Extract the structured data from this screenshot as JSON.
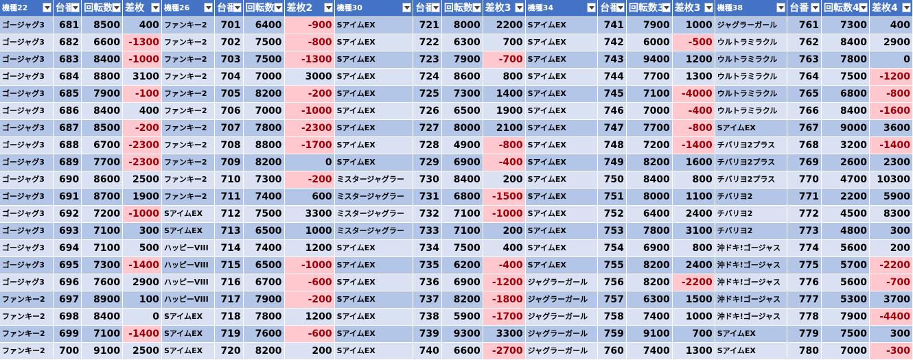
{
  "sheet": {
    "headers": [
      "機種22",
      "台番",
      "回転数",
      "差枚",
      "機種26",
      "台番",
      "回転数",
      "差枚2",
      "機種30",
      "台番",
      "回転数",
      "差枚3",
      "機種34",
      "台番",
      "回転数3",
      "差枚3",
      "機種38",
      "台番",
      "回転数4",
      "差枚4"
    ],
    "colors": {
      "header_bg": "#4472c4",
      "row_odd": "#b4c6e7",
      "row_even": "#d9e1f2",
      "negative_bg": "#ffc7ce",
      "negative_text": "#9c0006"
    },
    "icons": {
      "filter": "filter-dropdown-icon"
    },
    "rows": [
      [
        "ゴージャグ3",
        "681",
        "8500",
        "400",
        "ファンキー2",
        "701",
        "6400",
        "-900",
        "SアイムEX",
        "721",
        "8000",
        "2200",
        "SアイムEX",
        "741",
        "7900",
        "1000",
        "ジャグラーガール",
        "761",
        "7300",
        "400"
      ],
      [
        "ゴージャグ3",
        "682",
        "6600",
        "-1300",
        "ファンキー2",
        "702",
        "7500",
        "-800",
        "SアイムEX",
        "722",
        "6300",
        "700",
        "SアイムEX",
        "742",
        "6000",
        "-500",
        "ウルトラミラクル",
        "762",
        "8400",
        "2900"
      ],
      [
        "ゴージャグ3",
        "683",
        "8400",
        "-1000",
        "ファンキー2",
        "703",
        "7500",
        "-1300",
        "SアイムEX",
        "723",
        "7900",
        "-700",
        "SアイムEX",
        "743",
        "9400",
        "1200",
        "ウルトラミラクル",
        "763",
        "7800",
        "0"
      ],
      [
        "ゴージャグ3",
        "684",
        "8800",
        "3100",
        "ファンキー2",
        "704",
        "7000",
        "3000",
        "SアイムEX",
        "724",
        "8600",
        "800",
        "SアイムEX",
        "744",
        "7700",
        "1300",
        "ウルトラミラクル",
        "764",
        "7500",
        "-1200"
      ],
      [
        "ゴージャグ3",
        "685",
        "7900",
        "-100",
        "ファンキー2",
        "705",
        "8200",
        "-200",
        "SアイムEX",
        "725",
        "7300",
        "1400",
        "SアイムEX",
        "745",
        "7100",
        "-4000",
        "ウルトラミラクル",
        "765",
        "6800",
        "-800"
      ],
      [
        "ゴージャグ3",
        "686",
        "8400",
        "400",
        "ファンキー2",
        "706",
        "7000",
        "-1000",
        "SアイムEX",
        "726",
        "6500",
        "1900",
        "SアイムEX",
        "746",
        "7000",
        "-400",
        "ウルトラミラクル",
        "766",
        "8400",
        "-1600"
      ],
      [
        "ゴージャグ3",
        "687",
        "8500",
        "-200",
        "ファンキー2",
        "707",
        "7800",
        "-2300",
        "SアイムEX",
        "727",
        "8000",
        "2100",
        "SアイムEX",
        "747",
        "7700",
        "-800",
        "SアイムEX",
        "767",
        "9000",
        "3600"
      ],
      [
        "ゴージャグ3",
        "688",
        "6700",
        "-2300",
        "ファンキー2",
        "708",
        "8800",
        "-1700",
        "SアイムEX",
        "728",
        "4900",
        "-800",
        "SアイムEX",
        "748",
        "7200",
        "-1400",
        "チバリヨ2プラス",
        "768",
        "3200",
        "-1400"
      ],
      [
        "ゴージャグ3",
        "689",
        "7700",
        "-2300",
        "ファンキー2",
        "709",
        "8200",
        "0",
        "SアイムEX",
        "729",
        "6900",
        "-400",
        "SアイムEX",
        "749",
        "8200",
        "1600",
        "チバリヨ2プラス",
        "769",
        "2600",
        "2300"
      ],
      [
        "ゴージャグ3",
        "690",
        "8600",
        "2500",
        "ファンキー2",
        "710",
        "7300",
        "-200",
        "ミスタージャグラー",
        "730",
        "8400",
        "200",
        "SアイムEX",
        "750",
        "8400",
        "800",
        "チバリヨ2プラス",
        "770",
        "4700",
        "10300"
      ],
      [
        "ゴージャグ3",
        "691",
        "8700",
        "1900",
        "ファンキー2",
        "711",
        "7400",
        "600",
        "ミスタージャグラー",
        "731",
        "6800",
        "-1500",
        "SアイムEX",
        "751",
        "8000",
        "1100",
        "チバリヨ2",
        "771",
        "2200",
        "5900"
      ],
      [
        "ゴージャグ3",
        "692",
        "7200",
        "-1000",
        "SアイムEX",
        "712",
        "7500",
        "3300",
        "ミスタージャグラー",
        "732",
        "7100",
        "-1000",
        "SアイムEX",
        "752",
        "6400",
        "2400",
        "チバリヨ2",
        "772",
        "4500",
        "8300"
      ],
      [
        "ゴージャグ3",
        "693",
        "7100",
        "300",
        "SアイムEX",
        "713",
        "6500",
        "1000",
        "ミスタージャグラー",
        "733",
        "7100",
        "200",
        "SアイムEX",
        "753",
        "7800",
        "3100",
        "チバリヨ2",
        "773",
        "4800",
        "300"
      ],
      [
        "ゴージャグ3",
        "694",
        "7100",
        "500",
        "ハッピーVIII",
        "714",
        "7400",
        "1200",
        "SアイムEX",
        "734",
        "7500",
        "400",
        "SアイムEX",
        "754",
        "6900",
        "800",
        "沖ドキ!ゴージャス",
        "774",
        "5600",
        "200"
      ],
      [
        "ゴージャグ3",
        "695",
        "7300",
        "-1400",
        "ハッピーVIII",
        "715",
        "6500",
        "-1000",
        "SアイムEX",
        "735",
        "6200",
        "-400",
        "SアイムEX",
        "755",
        "8200",
        "2400",
        "沖ドキ!ゴージャス",
        "775",
        "5700",
        "-2200"
      ],
      [
        "ゴージャグ3",
        "696",
        "7600",
        "2900",
        "ハッピーVIII",
        "716",
        "6700",
        "-600",
        "SアイムEX",
        "736",
        "6900",
        "-1200",
        "ジャグラーガール",
        "756",
        "8200",
        "-2200",
        "沖ドキ!ゴージャス",
        "776",
        "5600",
        "-700"
      ],
      [
        "ファンキー2",
        "697",
        "8900",
        "100",
        "ハッピーVIII",
        "717",
        "7900",
        "-200",
        "SアイムEX",
        "737",
        "8200",
        "-1800",
        "ジャグラーガール",
        "757",
        "6300",
        "1500",
        "沖ドキ!ゴージャス",
        "777",
        "5300",
        "3700"
      ],
      [
        "ファンキー2",
        "698",
        "8400",
        "0",
        "SアイムEX",
        "718",
        "7800",
        "1200",
        "SアイムEX",
        "738",
        "5900",
        "-1700",
        "ジャグラーガール",
        "758",
        "7400",
        "1000",
        "沖ドキ!ゴージャス",
        "778",
        "7900",
        "-4400"
      ],
      [
        "ファンキー2",
        "699",
        "7100",
        "-1400",
        "SアイムEX",
        "719",
        "7600",
        "-600",
        "SアイムEX",
        "739",
        "9300",
        "3300",
        "ジャグラーガール",
        "759",
        "9100",
        "700",
        "SアイムEX",
        "779",
        "7500",
        "300"
      ],
      [
        "ファンキー2",
        "700",
        "9100",
        "2500",
        "SアイムEX",
        "720",
        "8200",
        "200",
        "SアイムEX",
        "740",
        "6600",
        "-2700",
        "ジャグラーガール",
        "760",
        "7400",
        "1300",
        "SアイムEX",
        "780",
        "7000",
        "-300"
      ]
    ]
  }
}
